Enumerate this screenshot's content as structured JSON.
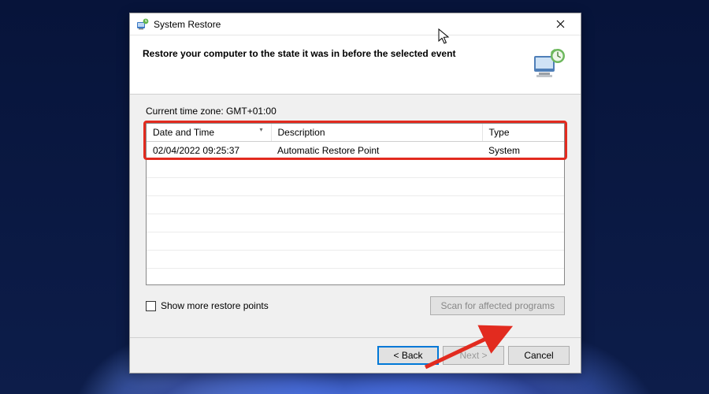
{
  "window": {
    "title": "System Restore"
  },
  "header": {
    "heading": "Restore your computer to the state it was in before the selected event"
  },
  "content": {
    "timezone_label": "Current time zone: GMT+01:00",
    "columns": {
      "date_time": "Date and Time",
      "description": "Description",
      "type": "Type"
    },
    "rows": [
      {
        "date_time": "02/04/2022 09:25:37",
        "description": "Automatic Restore Point",
        "type": "System"
      }
    ],
    "show_more_label": "Show more restore points",
    "scan_btn_label": "Scan for affected programs"
  },
  "footer": {
    "back": "< Back",
    "next": "Next >",
    "cancel": "Cancel"
  },
  "annotations": {
    "highlight_color": "#e22b1f",
    "arrow_color": "#e22b1f"
  }
}
